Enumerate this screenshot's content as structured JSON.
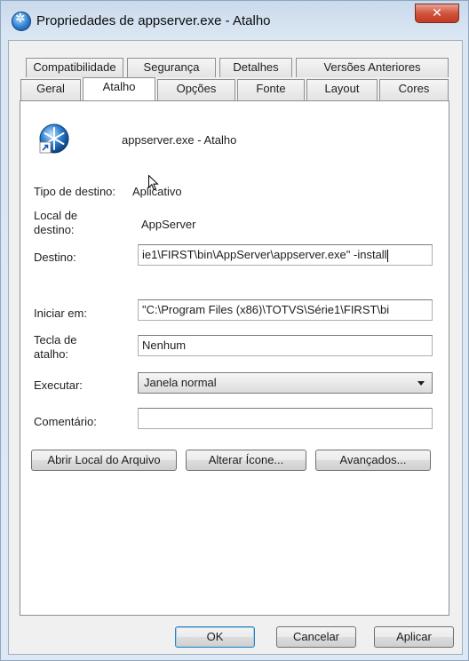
{
  "window": {
    "title": "Propriedades de appserver.exe - Atalho",
    "close_label": "✕"
  },
  "tabs_row1": [
    "Compatibilidade",
    "Segurança",
    "Detalhes",
    "Versões Anteriores"
  ],
  "tabs_row2": [
    "Geral",
    "Atalho",
    "Opções",
    "Fonte",
    "Layout",
    "Cores"
  ],
  "active_tab": "Atalho",
  "shortcut": {
    "name": "appserver.exe - Atalho",
    "icon": "appserver-snowflake-icon"
  },
  "fields": {
    "tipo_destino_label": "Tipo de destino:",
    "tipo_destino_value": "Aplicativo",
    "local_destino_label_1": "Local de",
    "local_destino_label_2": "destino:",
    "local_destino_value": "AppServer",
    "destino_label": "Destino:",
    "destino_value": "ie1\\FIRST\\bin\\AppServer\\appserver.exe\" -install",
    "iniciar_em_label": "Iniciar em:",
    "iniciar_em_value": "\"C:\\Program Files (x86)\\TOTVS\\Série1\\FIRST\\bi",
    "tecla_atalho_label_1": "Tecla de",
    "tecla_atalho_label_2": "atalho:",
    "tecla_atalho_value": "Nenhum",
    "executar_label": "Executar:",
    "executar_value": "Janela normal",
    "comentario_label": "Comentário:",
    "comentario_value": ""
  },
  "buttons": {
    "abrir_local": "Abrir Local do Arquivo",
    "alterar_icone": "Alterar Ícone...",
    "avancados": "Avançados...",
    "ok": "OK",
    "cancelar": "Cancelar",
    "aplicar": "Aplicar"
  }
}
